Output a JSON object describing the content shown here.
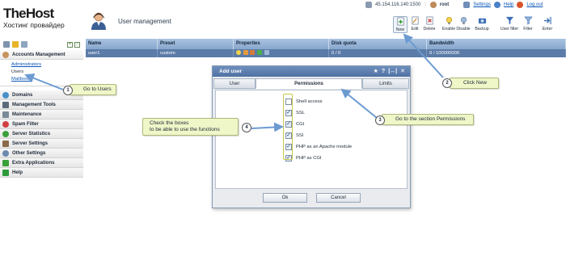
{
  "app": {
    "logo_main": "TheHost",
    "logo_sub": "Хостинг провайдер",
    "page_title": "User management"
  },
  "topbar": {
    "server": "45.154.116.140:1500",
    "separator": "::",
    "user": "root",
    "settings": "Settings",
    "help": "Help",
    "logout": "Log out"
  },
  "toolbar": {
    "new": "New",
    "edit": "Edit",
    "delete": "Delete",
    "enable": "Enable",
    "disable": "Disable",
    "backup": "Backup",
    "user_filter": "User filter",
    "filter": "Filter",
    "enter": "Enter"
  },
  "sidebar": {
    "accounts": "Accounts Management",
    "sub": [
      "Administrators",
      "Users",
      "Mailboxes"
    ],
    "items": [
      "Domains",
      "Management Tools",
      "Maintenance",
      "Spam Filter",
      "Server Statistics",
      "Server Settings",
      "Other Settings",
      "Extra Applications",
      "Help"
    ]
  },
  "table": {
    "headers": [
      "Name",
      "Preset",
      "Properties",
      "Disk quota",
      "Bandwidth"
    ],
    "rows": [
      {
        "name": "user1",
        "preset": "custom",
        "disk": "0 / 0",
        "bandwidth": "0 / 100000000"
      }
    ]
  },
  "dialog": {
    "title": "Add user",
    "ctrl_glyphs": [
      "★",
      "?",
      "|↔|",
      "✕"
    ],
    "tabs": [
      "User",
      "Permissions",
      "Limits"
    ],
    "permissions": [
      {
        "label": "Shell access",
        "checked": false
      },
      {
        "label": "SSL",
        "checked": true
      },
      {
        "label": "CGI",
        "checked": true
      },
      {
        "label": "SSI",
        "checked": true
      },
      {
        "label": "PHP as an Apache module",
        "checked": true
      },
      {
        "label": "PHP as CGI",
        "checked": true
      }
    ],
    "ok": "Ok",
    "cancel": "Cancel"
  },
  "callouts": {
    "c1": {
      "num": "1",
      "text": "Go to Users"
    },
    "c2": {
      "num": "2",
      "text": "Click New"
    },
    "c3": {
      "num": "3",
      "text": "Go to the section Permissions"
    },
    "c4": {
      "num": "4",
      "line1": "Check the boxes",
      "line2": "to be able to use the functions"
    }
  },
  "colors": {
    "header_blue": "#87a6cc",
    "row_selected": "#5b7ba8",
    "callout_bg": "#eff6c8",
    "arrow_blue": "#6c9bd1"
  }
}
